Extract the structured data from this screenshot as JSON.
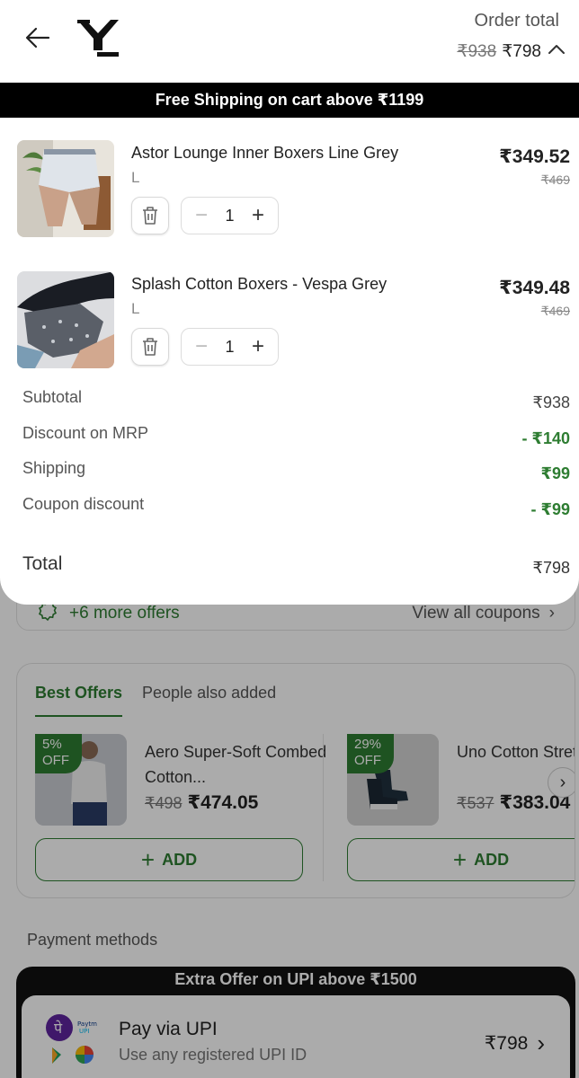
{
  "header": {
    "order_total_label": "Order total",
    "order_total_mrp": "₹938",
    "order_total_price": "₹798"
  },
  "banner": {
    "text": "Free Shipping on cart above ₹1199"
  },
  "cart_items": [
    {
      "name": "Astor Lounge Inner Boxers Line Grey",
      "size": "L",
      "qty": "1",
      "price": "₹349.52",
      "mrp": "₹469"
    },
    {
      "name": "Splash Cotton Boxers - Vespa Grey",
      "size": "L",
      "qty": "1",
      "price": "₹349.48",
      "mrp": "₹469"
    }
  ],
  "summary": {
    "subtotal_label": "Subtotal",
    "subtotal_value": "₹938",
    "discount_label": "Discount on MRP",
    "discount_value": "- ₹140",
    "shipping_label": "Shipping",
    "shipping_value": "₹99",
    "coupon_label": "Coupon discount",
    "coupon_value": "- ₹99",
    "total_label": "Total",
    "total_value": "₹798"
  },
  "coupons": {
    "more_offers": "+6 more offers",
    "view_all": "View all coupons"
  },
  "offers": {
    "tabs": [
      "Best Offers",
      "People also added"
    ],
    "products": [
      {
        "discount_tag_line1": "5%",
        "discount_tag_line2": "OFF",
        "name": "Aero Super-Soft Combed Cotton...",
        "mrp": "₹498",
        "price": "₹474.05",
        "add_label": "ADD"
      },
      {
        "discount_tag_line1": "29%",
        "discount_tag_line2": "OFF",
        "name": "Uno Cotton Stretch Blend Socks",
        "mrp": "₹537",
        "price": "₹383.04",
        "add_label": "ADD"
      }
    ]
  },
  "payment": {
    "section_label": "Payment methods",
    "upi_banner": "Extra Offer on UPI above ₹1500",
    "upi_title": "Pay via UPI",
    "upi_subtitle": "Use any registered UPI ID",
    "upi_amount": "₹798"
  },
  "colors": {
    "accent_green": "#2e7d32",
    "banner_black": "#000000"
  }
}
